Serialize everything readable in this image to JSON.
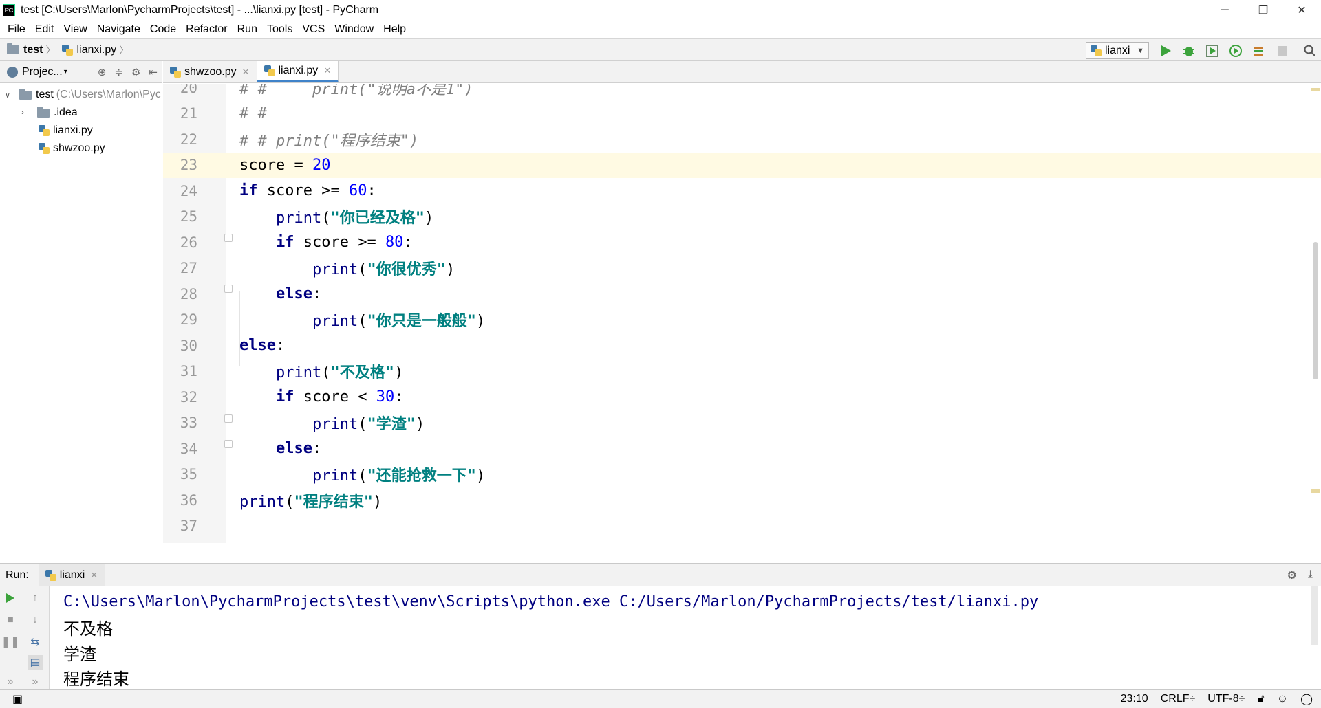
{
  "window": {
    "title": "test [C:\\Users\\Marlon\\PycharmProjects\\test] - ...\\lianxi.py [test] - PyCharm",
    "logo_text": "PC"
  },
  "menu": [
    "File",
    "Edit",
    "View",
    "Navigate",
    "Code",
    "Refactor",
    "Run",
    "Tools",
    "VCS",
    "Window",
    "Help"
  ],
  "breadcrumb": {
    "project": "test",
    "file": "lianxi.py"
  },
  "run_config": {
    "name": "lianxi"
  },
  "project_panel": {
    "title": "Projec...",
    "tree": [
      {
        "label": "test",
        "path": "(C:\\Users\\Marlon\\Pyc",
        "type": "folder",
        "expanded": true
      },
      {
        "label": ".idea",
        "type": "folder",
        "expanded": false
      },
      {
        "label": "lianxi.py",
        "type": "file"
      },
      {
        "label": "shwzoo.py",
        "type": "file"
      }
    ]
  },
  "tabs": [
    {
      "label": "shwzoo.py",
      "active": false
    },
    {
      "label": "lianxi.py",
      "active": true
    }
  ],
  "editor": {
    "current_line": 23,
    "lines": [
      {
        "n": "20",
        "tokens": [
          {
            "t": "cmt",
            "v": "# #     print(\"说明a不是1\")"
          }
        ]
      },
      {
        "n": "21",
        "tokens": [
          {
            "t": "cmt",
            "v": "# #"
          }
        ]
      },
      {
        "n": "22",
        "tokens": [
          {
            "t": "cmt",
            "v": "# # print(\"程序结束\")"
          }
        ]
      },
      {
        "n": "23",
        "tokens": [
          {
            "t": "plain",
            "v": "score = "
          },
          {
            "t": "num",
            "v": "20"
          }
        ]
      },
      {
        "n": "24",
        "tokens": [
          {
            "t": "kw",
            "v": "if"
          },
          {
            "t": "plain",
            "v": " score >= "
          },
          {
            "t": "num",
            "v": "60"
          },
          {
            "t": "plain",
            "v": ":"
          }
        ]
      },
      {
        "n": "25",
        "tokens": [
          {
            "t": "plain",
            "v": "    "
          },
          {
            "t": "fn",
            "v": "print"
          },
          {
            "t": "plain",
            "v": "("
          },
          {
            "t": "str",
            "v": "\"你已经及格\""
          },
          {
            "t": "plain",
            "v": ")"
          }
        ]
      },
      {
        "n": "26",
        "tokens": [
          {
            "t": "plain",
            "v": "    "
          },
          {
            "t": "kw",
            "v": "if"
          },
          {
            "t": "plain",
            "v": " score >= "
          },
          {
            "t": "num",
            "v": "80"
          },
          {
            "t": "plain",
            "v": ":"
          }
        ]
      },
      {
        "n": "27",
        "tokens": [
          {
            "t": "plain",
            "v": "        "
          },
          {
            "t": "fn",
            "v": "print"
          },
          {
            "t": "plain",
            "v": "("
          },
          {
            "t": "str",
            "v": "\"你很优秀\""
          },
          {
            "t": "plain",
            "v": ")"
          }
        ]
      },
      {
        "n": "28",
        "tokens": [
          {
            "t": "plain",
            "v": "    "
          },
          {
            "t": "kw",
            "v": "else"
          },
          {
            "t": "plain",
            "v": ":"
          }
        ]
      },
      {
        "n": "29",
        "tokens": [
          {
            "t": "plain",
            "v": "        "
          },
          {
            "t": "fn",
            "v": "print"
          },
          {
            "t": "plain",
            "v": "("
          },
          {
            "t": "str",
            "v": "\"你只是一般般\""
          },
          {
            "t": "plain",
            "v": ")"
          }
        ]
      },
      {
        "n": "30",
        "tokens": [
          {
            "t": "kw",
            "v": "else"
          },
          {
            "t": "plain",
            "v": ":"
          }
        ]
      },
      {
        "n": "31",
        "tokens": [
          {
            "t": "plain",
            "v": "    "
          },
          {
            "t": "fn",
            "v": "print"
          },
          {
            "t": "plain",
            "v": "("
          },
          {
            "t": "str",
            "v": "\"不及格\""
          },
          {
            "t": "plain",
            "v": ")"
          }
        ]
      },
      {
        "n": "32",
        "tokens": [
          {
            "t": "plain",
            "v": "    "
          },
          {
            "t": "kw",
            "v": "if"
          },
          {
            "t": "plain",
            "v": " score < "
          },
          {
            "t": "num",
            "v": "30"
          },
          {
            "t": "plain",
            "v": ":"
          }
        ]
      },
      {
        "n": "33",
        "tokens": [
          {
            "t": "plain",
            "v": "        "
          },
          {
            "t": "fn",
            "v": "print"
          },
          {
            "t": "plain",
            "v": "("
          },
          {
            "t": "str",
            "v": "\"学渣\""
          },
          {
            "t": "plain",
            "v": ")"
          }
        ]
      },
      {
        "n": "34",
        "tokens": [
          {
            "t": "plain",
            "v": "    "
          },
          {
            "t": "kw",
            "v": "else"
          },
          {
            "t": "plain",
            "v": ":"
          }
        ]
      },
      {
        "n": "35",
        "tokens": [
          {
            "t": "plain",
            "v": "        "
          },
          {
            "t": "fn",
            "v": "print"
          },
          {
            "t": "plain",
            "v": "("
          },
          {
            "t": "str",
            "v": "\"还能抢救一下\""
          },
          {
            "t": "plain",
            "v": ")"
          }
        ]
      },
      {
        "n": "36",
        "tokens": [
          {
            "t": "fn",
            "v": "print"
          },
          {
            "t": "plain",
            "v": "("
          },
          {
            "t": "str",
            "v": "\"程序结束\""
          },
          {
            "t": "plain",
            "v": ")"
          }
        ]
      },
      {
        "n": "37",
        "tokens": []
      }
    ]
  },
  "run_panel": {
    "label": "Run:",
    "tab": "lianxi",
    "output": [
      "C:\\Users\\Marlon\\PycharmProjects\\test\\venv\\Scripts\\python.exe C:/Users/Marlon/PycharmProjects/test/lianxi.py",
      "不及格",
      "学渣",
      "程序结束"
    ]
  },
  "status": {
    "position": "23:10",
    "line_sep": "CRLF÷",
    "encoding": "UTF-8÷"
  },
  "colors": {
    "keyword": "#000080",
    "string": "#008080",
    "number": "#0000ff",
    "comment": "#808080",
    "current_line": "#fffae3",
    "run_green": "#3ca33c"
  }
}
